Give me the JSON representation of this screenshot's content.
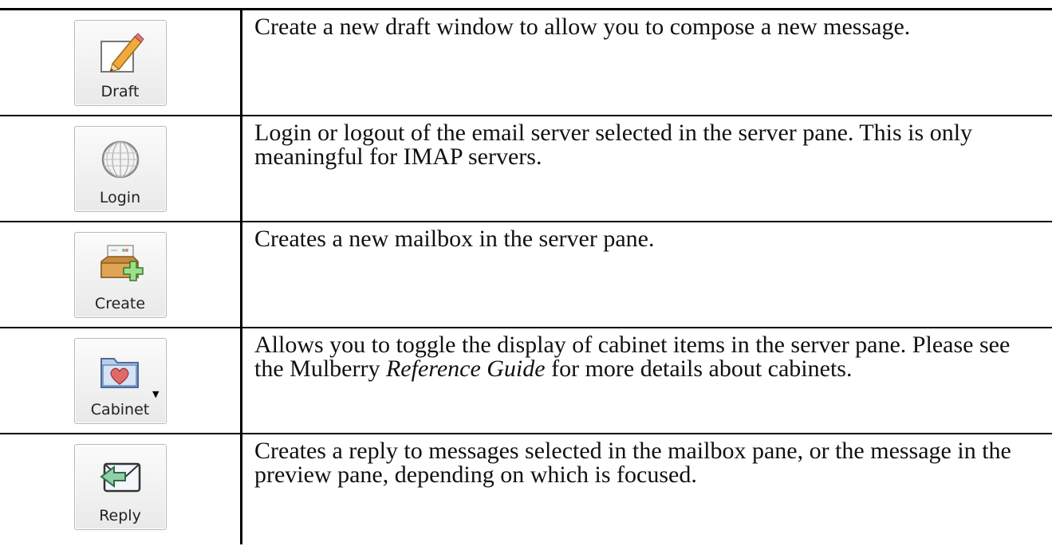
{
  "rows": [
    {
      "label": "Draft",
      "icon": "pencil-icon",
      "text": "Create a new draft window to allow you to compose a new message."
    },
    {
      "label": "Login",
      "icon": "globe-icon",
      "text": "Login or logout of the email server selected in the server pane. This is only meaningful for IMAP servers."
    },
    {
      "label": "Create",
      "icon": "create-mailbox-icon",
      "text": "Creates a new mailbox in the server pane."
    },
    {
      "label": "Cabinet",
      "icon": "cabinet-folder-icon",
      "text_before": "Allows you to toggle the display of cabinet items in the server pane. Please see the Mulberry ",
      "text_italic": "Reference Guide",
      "text_after": " for more details about cabinets."
    },
    {
      "label": "Reply",
      "icon": "reply-icon",
      "text": "Creates a reply to messages selected in the mailbox pane, or the message in the preview pane, depending on which is focused."
    }
  ]
}
